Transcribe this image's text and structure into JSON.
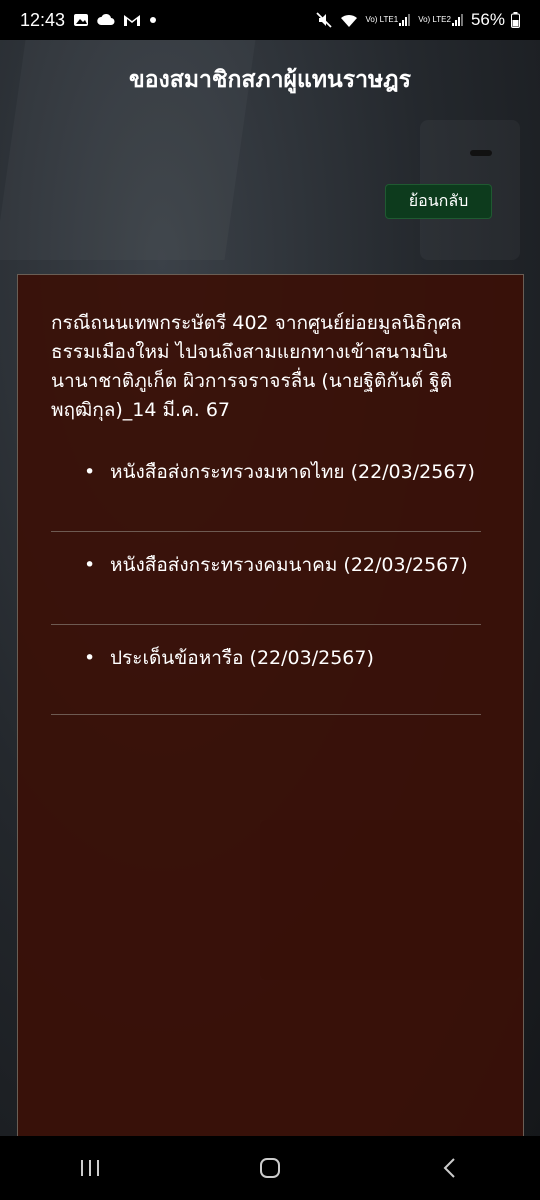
{
  "status": {
    "time": "12:43",
    "battery": "56%",
    "net1": "Vo) LTE1",
    "net2": "Vo) LTE2"
  },
  "header": {
    "title": "ของสมาชิกสภาผู้แทนราษฎร"
  },
  "back_button": "ย้อนกลับ",
  "panel": {
    "title": "กรณีถนนเทพกระษัตรี 402 จากศูนย์ย่อยมูลนิธิกุศลธรรมเมืองใหม่ ไปจนถึงสามแยกทางเข้าสนามบินนานาชาติภูเก็ต ผิวการจราจรลื่น (นายฐิติกันต์ ฐิติพฤฒิกุล)_14 มี.ค. 67",
    "items": [
      {
        "label": "หนังสือส่งกระทรวงมหาดไทย (22/03/2567)"
      },
      {
        "label": "หนังสือส่งกระทรวงคมนาคม (22/03/2567)"
      },
      {
        "label": "ประเด็นข้อหารือ (22/03/2567)"
      }
    ]
  },
  "colors": {
    "panel_bg": "#3a1008",
    "back_button_bg": "#0d3b1d"
  }
}
